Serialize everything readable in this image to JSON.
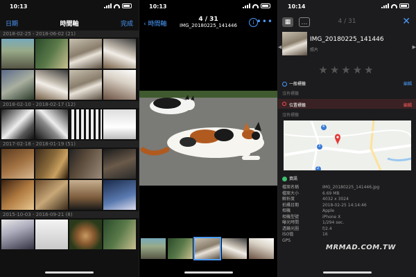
{
  "panel1": {
    "status_time": "10:13",
    "nav": {
      "left": "日期",
      "title": "時間軸",
      "right": "完成"
    },
    "groups": [
      {
        "header": "2018-02-25 - 2018-06-02 (21)"
      },
      {
        "header": "2018-02-10 - 2018-02-17 (12)"
      },
      {
        "header": "2017-02-18 - 2018-01-19 (51)"
      },
      {
        "header": "2015-10-03 - 2016-09-21 (8)"
      }
    ]
  },
  "panel2": {
    "status_time": "10:13",
    "nav": {
      "back": "時間軸",
      "count": "4 / 31",
      "filename": "IMG_20180225_141446",
      "info_icon": "i",
      "more_icon": "•••"
    }
  },
  "panel3": {
    "status_time": "10:14",
    "count": "4 / 31",
    "close": "✕",
    "filename": "IMG_20180225_141446",
    "sublabel": "照片",
    "stars": "★★★★★",
    "tag1": {
      "label": "一般標籤",
      "edit": "編輯"
    },
    "no_tag": "沒有標籤",
    "location_tag": {
      "label": "位置標籤",
      "edit": "編輯"
    },
    "no_tag2": "沒有標籤",
    "info_header": "資訊",
    "info": [
      {
        "k": "檔案名稱",
        "v": "IMG_20180225_141446.jpg"
      },
      {
        "k": "檔案大小",
        "v": "6.69 MB"
      },
      {
        "k": "解析度",
        "v": "4032 x 3024"
      },
      {
        "k": "拍攝日期",
        "v": "2018-02-25 14:14:46"
      },
      {
        "k": "相機",
        "v": "Apple"
      },
      {
        "k": "相機型號",
        "v": "iPhone X"
      },
      {
        "k": "曝光時間",
        "v": "1/294 sec."
      },
      {
        "k": "透鏡光圈",
        "v": "f/2.4"
      },
      {
        "k": "ISO值",
        "v": "16"
      },
      {
        "k": "GPS",
        "v": ""
      }
    ],
    "map_labels": [
      "4",
      "3",
      "2"
    ]
  },
  "watermark": "MRMAD.COM.TW",
  "colors": {
    "accent": "#4a9cff",
    "location": "#ff4d4d",
    "info": "#3fc06f"
  }
}
